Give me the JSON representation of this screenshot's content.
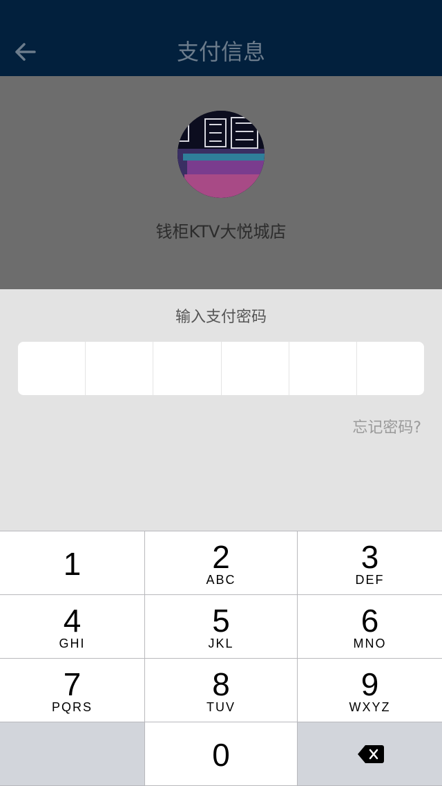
{
  "nav": {
    "title": "支付信息",
    "back_icon": "arrow-left-icon"
  },
  "merchant": {
    "name": "钱柜KTV大悦城店"
  },
  "password": {
    "title": "输入支付密码",
    "digits_entered": 0,
    "length": 6,
    "forgot": "忘记密码?"
  },
  "keypad": {
    "keys": [
      {
        "num": "1",
        "letters": ""
      },
      {
        "num": "2",
        "letters": "ABC"
      },
      {
        "num": "3",
        "letters": "DEF"
      },
      {
        "num": "4",
        "letters": "GHI"
      },
      {
        "num": "5",
        "letters": "JKL"
      },
      {
        "num": "6",
        "letters": "MNO"
      },
      {
        "num": "7",
        "letters": "PQRS"
      },
      {
        "num": "8",
        "letters": "TUV"
      },
      {
        "num": "9",
        "letters": "WXYZ"
      }
    ],
    "zero": "0",
    "delete_icon": "backspace-icon"
  },
  "colors": {
    "navbar": "#02203d",
    "overlay": "#6d6d6d",
    "background": "#e3e3e3"
  }
}
